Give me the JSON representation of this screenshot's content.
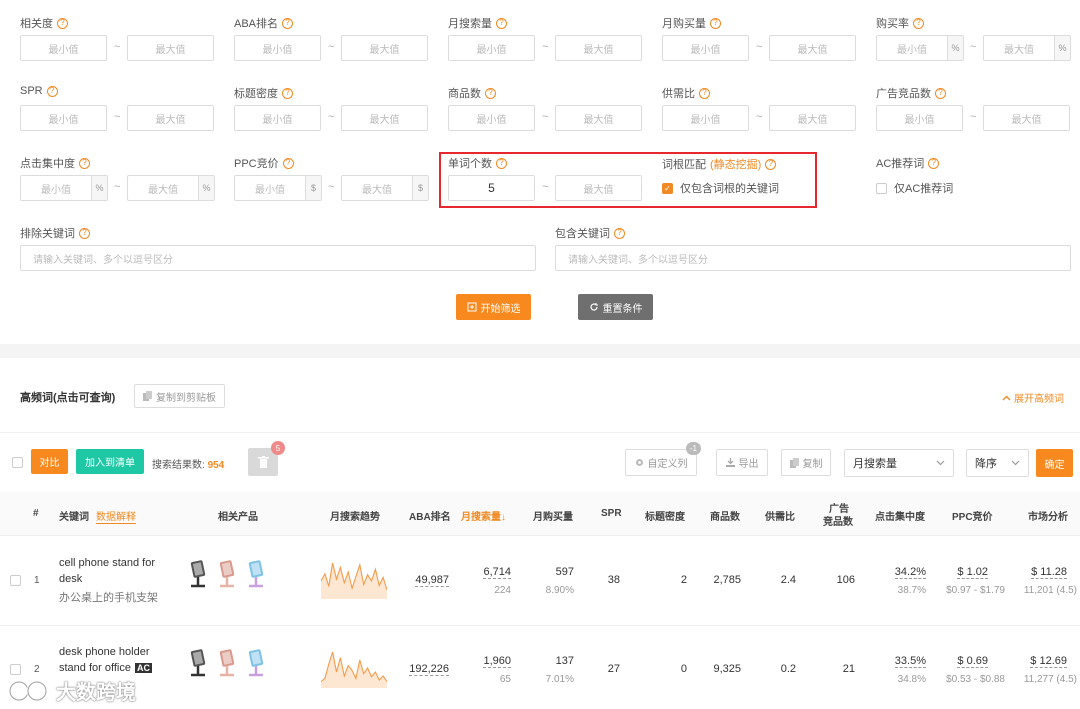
{
  "filters": {
    "row1": [
      {
        "label": "相关度",
        "min": "最小值",
        "max": "最大值"
      },
      {
        "label": "ABA排名",
        "min": "最小值",
        "max": "最大值"
      },
      {
        "label": "月搜索量",
        "min": "最小值",
        "max": "最大值"
      },
      {
        "label": "月购买量",
        "min": "最小值",
        "max": "最大值"
      },
      {
        "label": "购买率",
        "min": "最小值",
        "max": "最大值",
        "unit": "%"
      }
    ],
    "row2": [
      {
        "label": "SPR",
        "min": "最小值",
        "max": "最大值"
      },
      {
        "label": "标题密度",
        "min": "最小值",
        "max": "最大值"
      },
      {
        "label": "商品数",
        "min": "最小值",
        "max": "最大值"
      },
      {
        "label": "供需比",
        "min": "最小值",
        "max": "最大值"
      },
      {
        "label": "广告竞品数",
        "min": "最小值",
        "max": "最大值"
      }
    ],
    "click_conc": {
      "label": "点击集中度",
      "min": "最小值",
      "max": "最大值",
      "unit": "%"
    },
    "ppc": {
      "label": "PPC竞价",
      "min": "最小值",
      "max": "最大值",
      "unit": "$"
    },
    "word_count": {
      "label": "单词个数",
      "value": "5",
      "max": "最大值"
    },
    "root_match": {
      "label": "词根匹配",
      "link": "(静态挖掘)",
      "checkbox_label": "仅包含词根的关键词"
    },
    "ac": {
      "label": "AC推荐词",
      "checkbox_label": "仅AC推荐词"
    },
    "exclude": {
      "label": "排除关键词",
      "placeholder": "请输入关键词、多个以逗号区分"
    },
    "include": {
      "label": "包含关键词",
      "placeholder": "请输入关键词、多个以逗号区分"
    },
    "separator": "~",
    "q_glyph": "?",
    "check_glyph": "✓"
  },
  "actions": {
    "start": "开始筛选",
    "reset": "重置条件"
  },
  "hf": {
    "title": "高频词(点击可查询)",
    "copy": "复制到剪贴板",
    "expand": "展开高频词"
  },
  "toolbar": {
    "compare": "对比",
    "add_list": "加入到清单",
    "result_label": "搜索结果数:",
    "result_count": "954",
    "trash_badge": "5",
    "custom_cols": "自定义列",
    "custom_badge": "-1",
    "export": "导出",
    "copy": "复制",
    "sort_field": "月搜索量",
    "sort_order": "降序",
    "confirm": "确定"
  },
  "table": {
    "headers": {
      "idx": "#",
      "keyword": "关键词",
      "explain": "数据解释",
      "products": "相关产品",
      "trend": "月搜索趋势",
      "aba": "ABA排名",
      "search": "月搜索量↓",
      "buy": "月购买量",
      "spr": "SPR",
      "title_density": "标题密度",
      "goods": "商品数",
      "supply": "供需比",
      "ads_l1": "广告",
      "ads_l2": "竞品数",
      "click": "点击集中度",
      "ppc": "PPC竞价",
      "market": "市场分析"
    },
    "rows": [
      {
        "idx": "1",
        "kw1": "cell phone stand for",
        "kw2": "desk",
        "kw_cn": "办公桌上的手机支架",
        "ac": "",
        "aba": "49,987",
        "search": "6,714",
        "search_sub": "224",
        "buy": "597",
        "buy_sub": "8.90%",
        "spr": "38",
        "title_density": "2",
        "goods": "2,785",
        "supply": "2.4",
        "ads": "106",
        "click": "34.2%",
        "click_sub": "38.7%",
        "ppc": "$ 1.02",
        "ppc_sub": "$0.97 - $1.79",
        "market": "$ 11.28",
        "market_sub": "11,201 (4.5)",
        "trend": [
          20,
          28,
          14,
          40,
          22,
          35,
          18,
          30,
          12,
          25,
          38,
          16,
          27,
          20,
          33,
          15,
          24,
          10
        ]
      },
      {
        "idx": "2",
        "kw1": "desk phone holder",
        "kw2": "stand for office",
        "kw_cn": "",
        "ac": "AC",
        "aba": "192,226",
        "search": "1,960",
        "search_sub": "65",
        "buy": "137",
        "buy_sub": "7.01%",
        "spr": "27",
        "title_density": "0",
        "goods": "9,325",
        "supply": "0.2",
        "ads": "21",
        "click": "33.5%",
        "click_sub": "34.8%",
        "ppc": "$ 0.69",
        "ppc_sub": "$0.53 - $0.88",
        "market": "$ 12.69",
        "market_sub": "11,277 (4.5)",
        "trend": [
          8,
          12,
          30,
          45,
          20,
          38,
          15,
          28,
          22,
          12,
          35,
          18,
          25,
          14,
          20,
          10,
          15,
          8
        ]
      }
    ]
  },
  "watermark": "大数跨境",
  "colors": {
    "accent": "#f7891f",
    "teal": "#1ec8a5",
    "highlight": "#e8262d"
  }
}
